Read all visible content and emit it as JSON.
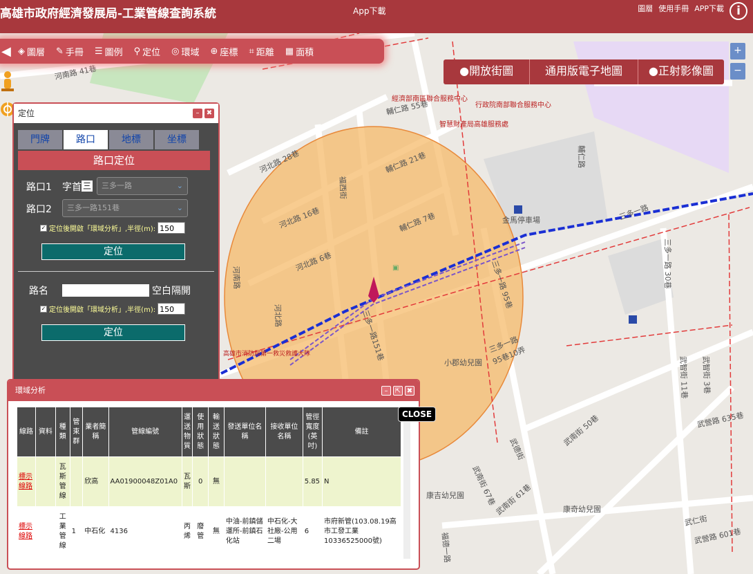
{
  "header": {
    "title": "高雄市政府經濟發展局-工業管線查詢系統",
    "center_link": "App下載",
    "right_links": [
      "圖層",
      "使用手冊",
      "APP下載"
    ],
    "info_icon": "i"
  },
  "toolbar": {
    "back": "◀",
    "items": [
      {
        "icon": "layers-icon",
        "glyph": "◈",
        "label": "圖層"
      },
      {
        "icon": "manual-icon",
        "glyph": "✎",
        "label": "手冊"
      },
      {
        "icon": "legend-icon",
        "glyph": "☰",
        "label": "圖例"
      },
      {
        "icon": "locate-icon",
        "glyph": "⚲",
        "label": "定位"
      },
      {
        "icon": "buffer-icon",
        "glyph": "◎",
        "label": "環域"
      },
      {
        "icon": "coordinate-icon",
        "glyph": "⊕",
        "label": "座標"
      },
      {
        "icon": "distance-icon",
        "glyph": "⌗",
        "label": "距離"
      },
      {
        "icon": "area-icon",
        "glyph": "▦",
        "label": "面積"
      }
    ]
  },
  "basemaps": [
    "●開放街圖",
    "通用版電子地圖",
    "●正射影像圖"
  ],
  "zoom": {
    "in": "+",
    "out": "−"
  },
  "locate_panel": {
    "title": "定位",
    "tabs": [
      "門牌",
      "路口",
      "地標",
      "坐標"
    ],
    "active_tab": "路口",
    "section_title": "路口定位",
    "cross1_label": "路口1",
    "first_char_label": "字首",
    "first_char_value": "三",
    "cross1_value": "三多一路",
    "cross2_label": "路口2",
    "cross2_value": "三多一路151巷",
    "buffer_text": "定位後開啟「環域分析」,半徑(m):",
    "radius1": "150",
    "locate_button": "定位",
    "road_label": "路名",
    "road_hint": "空白隔開",
    "radius2": "150",
    "locate_button2": "定位"
  },
  "ring_panel": {
    "title": "環域分析",
    "close_tooltip": "CLOSE",
    "columns": [
      "線路",
      "資料",
      "種類",
      "管束群",
      "業者簡稱",
      "管線編號",
      "運送物質",
      "使用狀態",
      "輸送狀態",
      "發送單位名稱",
      "接收單位名稱",
      "管徑寬度(英吋)",
      "備註"
    ],
    "rows": [
      [
        "標示線路",
        "",
        "瓦斯管線",
        "",
        "欣高",
        "AA01900048Z01A0",
        "瓦斯",
        "0",
        "無",
        "",
        "",
        "5.85",
        "N"
      ],
      [
        "標示線路",
        "",
        "工業管線",
        "1",
        "中石化",
        "4136",
        "丙烯",
        "廢管",
        "無",
        "中油-前鎮儲運所-前鎮石化站",
        "中石化-大社廠-公用二場",
        "6",
        "市府新管(103.08.19高市工發工業10336525000號)"
      ]
    ]
  },
  "map_labels": [
    "河南路 41巷",
    "三多一路",
    "輔仁路 55巷",
    "河北路 28巷",
    "輔仁路 21巷",
    "福西街",
    "河北路 16巷",
    "輔仁路 7巷",
    "河北路 6巷",
    "河南路",
    "河北路",
    "三多一路151巷",
    "三多一路 95巷",
    "三多一路 95巷10弄",
    "金馬停車場",
    "三多一路 30巷",
    "小郡幼兒園",
    "武智街 11巷",
    "武智街 3巷",
    "武營路 635巷",
    "武南街 50巷",
    "武德街",
    "武南街 67巷",
    "武南街 61巷",
    "康吉幼兒園",
    "康奇幼兒園",
    "武仁街",
    "武營路 601巷",
    "經濟部南區聯合服務中心",
    "行政院南部聯合服務中心",
    "智慧財產局高雄服務處",
    "高雄市消防局第一救災救護大隊",
    "輔仁路",
    "福德一路"
  ],
  "colors": {
    "header": "#a8383d",
    "accent": "#c94f56",
    "buffer": "#f5b865",
    "pipe_blue": "#1a2fd4",
    "pipe_purple": "#7a55c9",
    "red_line": "#e23b3b"
  }
}
